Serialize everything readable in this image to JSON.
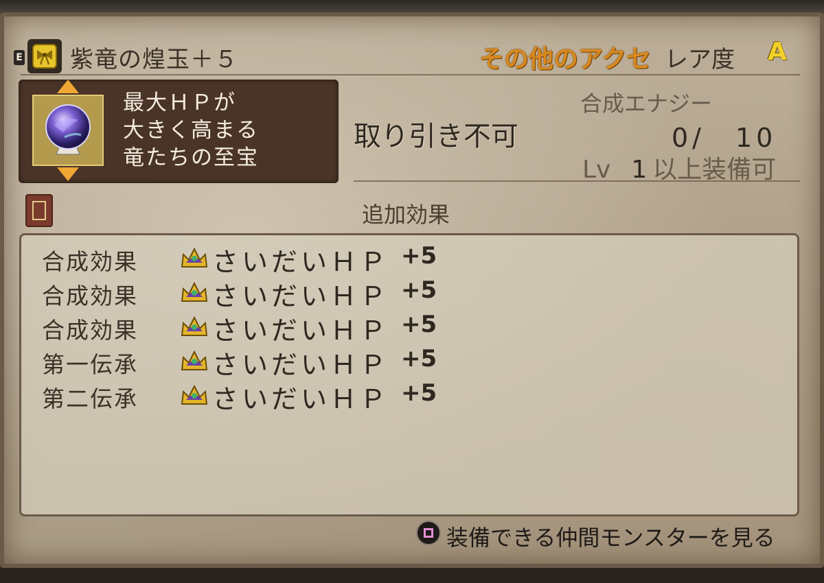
{
  "item": {
    "equipped_mark": "E",
    "name": "紫竜の煌玉＋５",
    "category": "その他のアクセ",
    "rarity_label": "レア度",
    "rarity_value": "A",
    "description": [
      "最大ＨＰが",
      "大きく高まる",
      "竜たちの至宝"
    ],
    "trade": "取り引き不可",
    "energy_label": "合成エナジー",
    "energy_value": "0/　10",
    "level_prefix": "Lv",
    "level_value": "1",
    "level_suffix": "以上装備可"
  },
  "extra_effects": {
    "label": "追加効果",
    "rows": [
      {
        "type": "合成効果",
        "name": "さいだいＨＰ",
        "value": "+5"
      },
      {
        "type": "合成効果",
        "name": "さいだいＨＰ",
        "value": "+5"
      },
      {
        "type": "合成効果",
        "name": "さいだいＨＰ",
        "value": "+5"
      },
      {
        "type": "第一伝承",
        "name": "さいだいＨＰ",
        "value": "+5"
      },
      {
        "type": "第二伝承",
        "name": "さいだいＨＰ",
        "value": "+5"
      }
    ]
  },
  "footer": {
    "button_icon": "square-button-icon",
    "text": "装備できる仲間モンスターを見る"
  },
  "colors": {
    "category": "#d7891f",
    "rarity": "#f3d12a",
    "panel_dark": "#4a3427",
    "parchment": "#bcae98"
  }
}
